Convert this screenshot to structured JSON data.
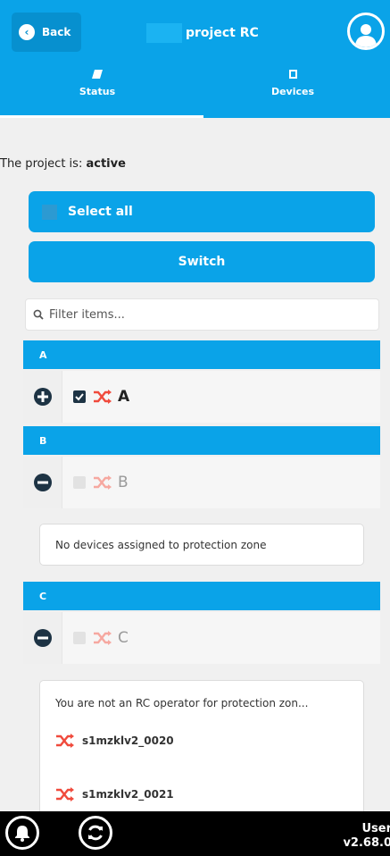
{
  "header": {
    "back_label": "Back",
    "title": "project RC",
    "tabs": [
      {
        "label": "Status",
        "icon": "tag-icon",
        "active": true
      },
      {
        "label": "Devices",
        "icon": "device-icon",
        "active": false
      }
    ]
  },
  "status": {
    "prefix": "The project is:",
    "value": "active"
  },
  "actions": {
    "select_all_label": "Select all",
    "switch_label": "Switch"
  },
  "filter": {
    "placeholder": "Filter items..."
  },
  "zones": [
    {
      "header": "A",
      "name": "A",
      "expanded": false,
      "checked": true
    },
    {
      "header": "B",
      "name": "B",
      "expanded": true,
      "checked": false,
      "message": "No devices assigned to protection zone"
    },
    {
      "header": "C",
      "name": "C",
      "expanded": true,
      "checked": false,
      "message": "You are not an RC operator for protection zon...",
      "devices": [
        "s1mzklv2_0020",
        "s1mzklv2_0021"
      ]
    }
  ],
  "footer": {
    "user_label": "User",
    "version": "v2.68.0"
  },
  "colors": {
    "primary": "#0aa3e8",
    "dark": "#1d3344",
    "switch_icon": "#f04a3c"
  }
}
